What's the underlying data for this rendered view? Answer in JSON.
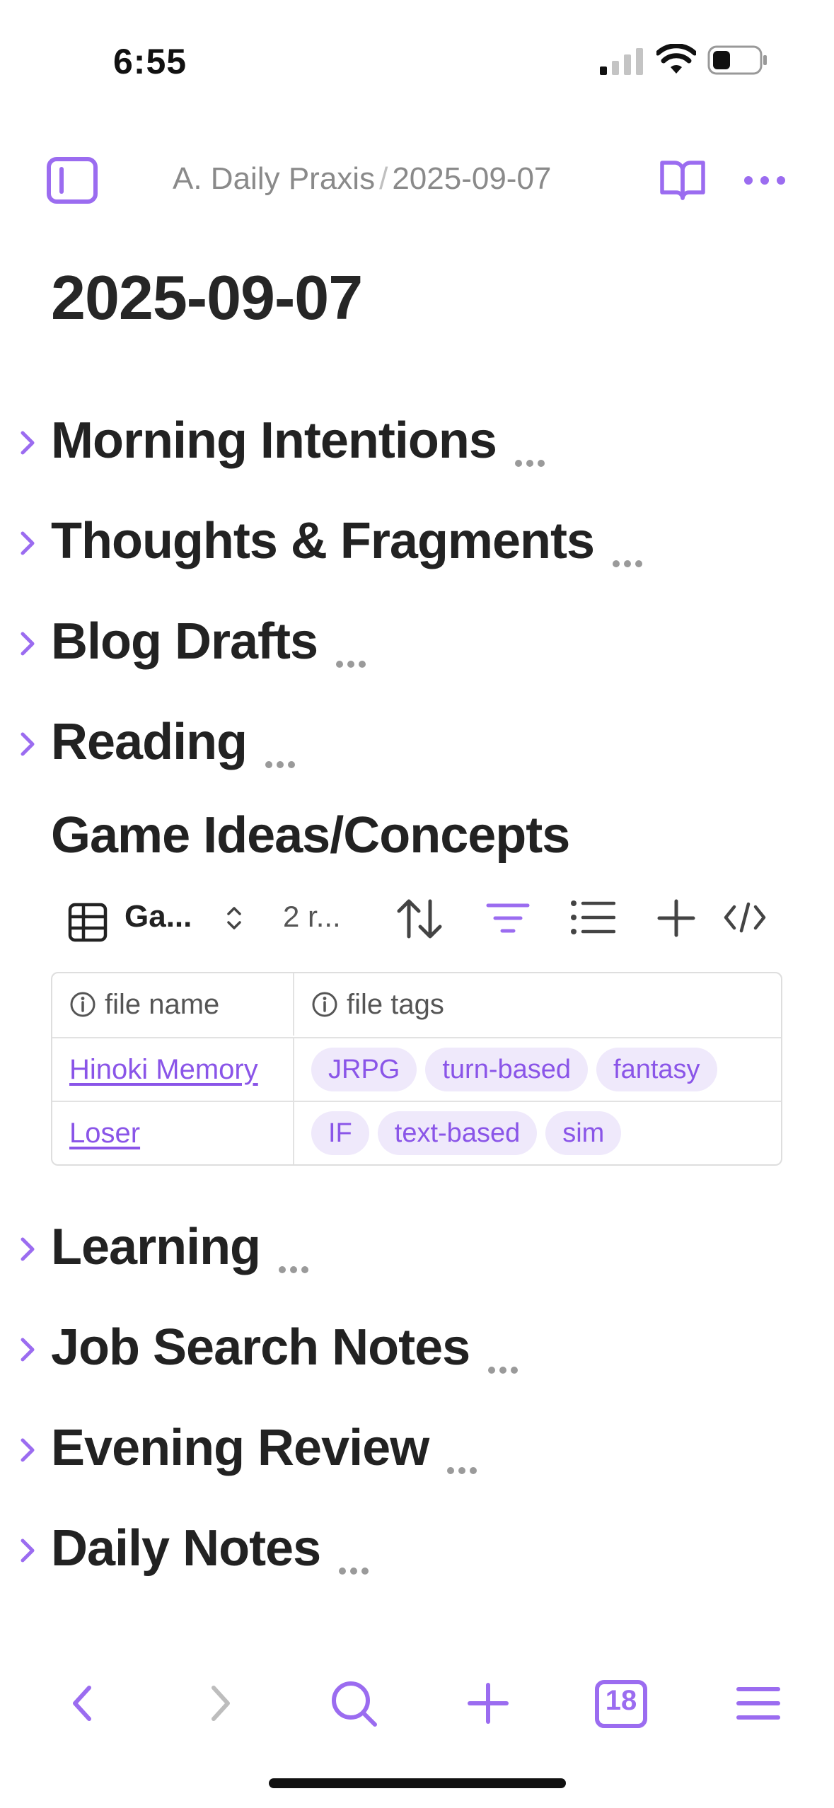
{
  "status_bar": {
    "time": "6:55"
  },
  "nav": {
    "breadcrumb_parent": "A. Daily Praxis",
    "breadcrumb_separator": "/",
    "breadcrumb_current": "2025-09-07"
  },
  "page": {
    "title": "2025-09-07"
  },
  "sections_top": [
    {
      "label": "Morning Intentions"
    },
    {
      "label": "Thoughts & Fragments"
    },
    {
      "label": "Blog Drafts"
    },
    {
      "label": "Reading"
    }
  ],
  "game_ideas": {
    "heading": "Game Ideas/Concepts",
    "toolbar": {
      "view_name": "Ga...",
      "rows_count": "2 r..."
    },
    "table": {
      "columns": [
        "file name",
        "file tags"
      ],
      "rows": [
        {
          "file": "Hinoki Memory",
          "tags": [
            "JRPG",
            "turn-based",
            "fantasy"
          ]
        },
        {
          "file": "Loser",
          "tags": [
            "IF",
            "text-based",
            "sim"
          ]
        }
      ]
    }
  },
  "sections_bottom": [
    {
      "label": "Learning"
    },
    {
      "label": "Job Search Notes"
    },
    {
      "label": "Evening Review"
    },
    {
      "label": "Daily Notes"
    }
  ],
  "bottom_bar": {
    "calendar_day": "18"
  },
  "colors": {
    "accent": "#9b6cf0",
    "link": "#8a55e8",
    "tag_bg": "#efe9fb",
    "text": "#222222",
    "muted": "#8a8a8a"
  }
}
